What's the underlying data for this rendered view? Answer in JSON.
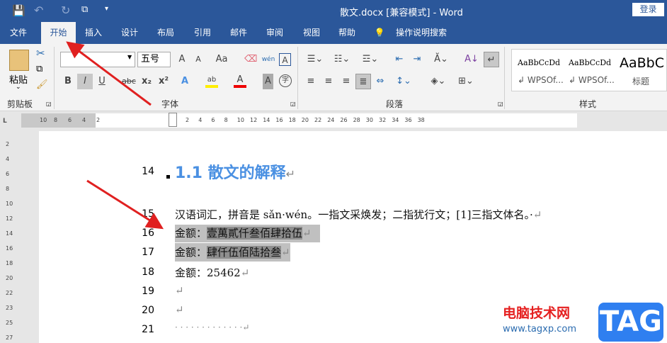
{
  "title": "散文.docx [兼容模式]  -  Word",
  "login": "登录",
  "quick_access": {
    "icons": [
      "save-icon",
      "undo-icon",
      "redo-icon",
      "touch-mode-icon",
      "customize-icon"
    ]
  },
  "menu": {
    "tabs": [
      "文件",
      "开始",
      "插入",
      "设计",
      "布局",
      "引用",
      "邮件",
      "审阅",
      "视图",
      "帮助"
    ],
    "search": "操作说明搜索",
    "active": "开始"
  },
  "ribbon": {
    "clipboard": {
      "paste": "粘贴",
      "label": "剪贴板"
    },
    "font": {
      "name": "",
      "size": "五号",
      "label": "字体",
      "bold": "B",
      "italic": "I",
      "underline": "U",
      "strike": "abc",
      "sub": "x₂",
      "sup": "x²",
      "grow": "A",
      "shrink": "A",
      "case": "Aa",
      "phonetic": "wén",
      "border": "A",
      "effects": "A",
      "highlight": "ab",
      "color": "A",
      "shade": "A",
      "enclose": "字"
    },
    "paragraph": {
      "label": "段落"
    },
    "styles": {
      "label": "样式",
      "items": [
        {
          "preview": "AaBbCcDd",
          "name": "↲ WPSOf..."
        },
        {
          "preview": "AaBbCcDd",
          "name": "↲ WPSOf..."
        },
        {
          "preview": "AaBbC",
          "name": "标题"
        }
      ]
    }
  },
  "ruler": {
    "left": [
      "10",
      "8",
      "6",
      "4",
      "2"
    ],
    "right": [
      "2",
      "4",
      "6",
      "8",
      "10",
      "12",
      "14",
      "16",
      "18",
      "20",
      "22",
      "24",
      "26",
      "28",
      "30",
      "32",
      "34",
      "36",
      "38"
    ],
    "vertical": [
      "2",
      "4",
      "6",
      "8",
      "10",
      "12",
      "14",
      "16",
      "18",
      "20",
      "22",
      "23",
      "25",
      "27"
    ]
  },
  "document": {
    "lines": [
      {
        "num": "14",
        "text": "1.1 散文的解释"
      },
      {
        "num": "15",
        "text": "汉语词汇，拼音是 sǎn·wén。一指文采焕发；二指犹行文；[1]三指文体名。·"
      },
      {
        "num": "16",
        "label": "金额：",
        "value": "壹萬貳仟叁佰肆拾伍"
      },
      {
        "num": "17",
        "label": "金额：",
        "value": "肆仟伍佰陆拾叁"
      },
      {
        "num": "18",
        "text": "金额：25462"
      },
      {
        "num": "19",
        "text": ""
      },
      {
        "num": "20",
        "text": ""
      },
      {
        "num": "21",
        "text": "· · · · · · · · · · · · ·"
      }
    ],
    "para_mark": "↵"
  },
  "watermark": {
    "site": "电脑技术网",
    "url": "www.tagxp.com",
    "tag": "TAG"
  },
  "colors": {
    "brand": "#2b579a",
    "heading": "#4a90e2",
    "arrow": "#e02020"
  }
}
